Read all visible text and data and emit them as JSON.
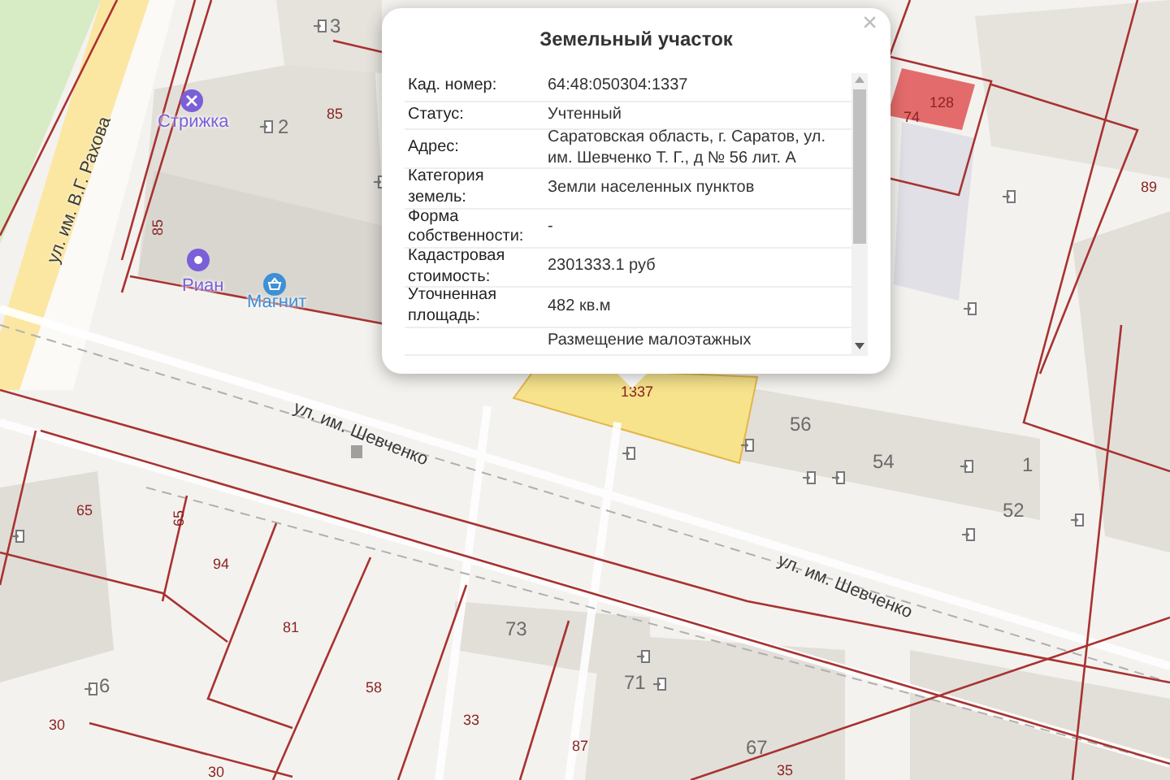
{
  "popup": {
    "title": "Земельный участок",
    "close": "×",
    "rows": [
      {
        "label": "Кад. номер:",
        "value": "64:48:050304:1337"
      },
      {
        "label": "Статус:",
        "value": "Учтенный"
      },
      {
        "label": "Адрес:",
        "value": "Саратовская область, г. Саратов, ул. им. Шевченко Т. Г., д № 56 лит. А"
      },
      {
        "label": "Категория земель:",
        "value": "Земли населенных пунктов"
      },
      {
        "label": "Форма собственности:",
        "value": "-"
      },
      {
        "label": "Кадастровая стоимость:",
        "value": "2301333.1 руб"
      },
      {
        "label": "Уточненная площадь:",
        "value": "482 кв.м"
      },
      {
        "value": "Размещение малоэтажных"
      }
    ]
  },
  "map": {
    "labels": [
      {
        "kind": "house",
        "text": "3"
      },
      {
        "kind": "poi",
        "text": "Стрижка",
        "color": "#7b5fd8"
      },
      {
        "kind": "house",
        "text": "2"
      },
      {
        "kind": "parcel",
        "text": "85"
      },
      {
        "kind": "street",
        "text": "ул. им. В.Г. Рахова"
      },
      {
        "kind": "parcel",
        "text": "85"
      },
      {
        "kind": "poi",
        "text": "Риан",
        "color": "#7b5fd8"
      },
      {
        "kind": "poi",
        "text": "Магнит",
        "color": "#3d8fd6"
      },
      {
        "kind": "parcel",
        "text": "74"
      },
      {
        "kind": "parcel",
        "text": "128"
      },
      {
        "kind": "parcel",
        "text": "89"
      },
      {
        "kind": "parcel",
        "text": "1337"
      },
      {
        "kind": "street",
        "text": "ул. им. Шевченко"
      },
      {
        "kind": "house",
        "text": "56"
      },
      {
        "kind": "house",
        "text": "54"
      },
      {
        "kind": "house",
        "text": "1"
      },
      {
        "kind": "house",
        "text": "52"
      },
      {
        "kind": "parcel",
        "text": "65"
      },
      {
        "kind": "parcel",
        "text": "65"
      },
      {
        "kind": "parcel",
        "text": "94"
      },
      {
        "kind": "street",
        "text": "ул. им. Шевченко"
      },
      {
        "kind": "parcel",
        "text": "81"
      },
      {
        "kind": "house",
        "text": "73"
      },
      {
        "kind": "house",
        "text": "6"
      },
      {
        "kind": "parcel",
        "text": "58"
      },
      {
        "kind": "house",
        "text": "71"
      },
      {
        "kind": "parcel",
        "text": "30"
      },
      {
        "kind": "parcel",
        "text": "33"
      },
      {
        "kind": "parcel",
        "text": "87"
      },
      {
        "kind": "house",
        "text": "67"
      },
      {
        "kind": "parcel",
        "text": "30"
      },
      {
        "kind": "parcel",
        "text": "35"
      }
    ]
  }
}
